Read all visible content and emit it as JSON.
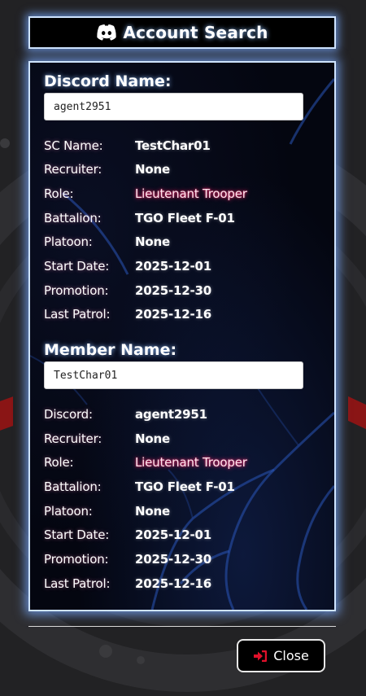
{
  "header": {
    "icon": "discord-icon",
    "title": "Account Search"
  },
  "discord_search": {
    "heading": "Discord Name:",
    "input_value": "agent2951",
    "rows": [
      {
        "label": "SC Name:",
        "value": "TestChar01"
      },
      {
        "label": "Recruiter:",
        "value": "None"
      },
      {
        "label": "Role:",
        "value": "Lieutenant Trooper"
      },
      {
        "label": "Battalion:",
        "value": "TGO Fleet F-01"
      },
      {
        "label": "Platoon:",
        "value": "None"
      },
      {
        "label": "Start Date:",
        "value": "2025-12-01"
      },
      {
        "label": "Promotion:",
        "value": "2025-12-30"
      },
      {
        "label": "Last Patrol:",
        "value": "2025-12-16"
      }
    ]
  },
  "member_search": {
    "heading": "Member Name:",
    "input_value": "TestChar01",
    "rows": [
      {
        "label": "Discord:",
        "value": "agent2951"
      },
      {
        "label": "Recruiter:",
        "value": "None"
      },
      {
        "label": "Role:",
        "value": "Lieutenant Trooper"
      },
      {
        "label": "Battalion:",
        "value": "TGO Fleet F-01"
      },
      {
        "label": "Platoon:",
        "value": "None"
      },
      {
        "label": "Start Date:",
        "value": "2025-12-01"
      },
      {
        "label": "Promotion:",
        "value": "2025-12-30"
      },
      {
        "label": "Last Patrol:",
        "value": "2025-12-16"
      }
    ]
  },
  "footer": {
    "close_icon": "sign-out-icon",
    "close_label": "Close"
  },
  "colors": {
    "glow": "#7aaaff",
    "role_glow": "#ff2870",
    "close_icon": "#e0102a"
  }
}
